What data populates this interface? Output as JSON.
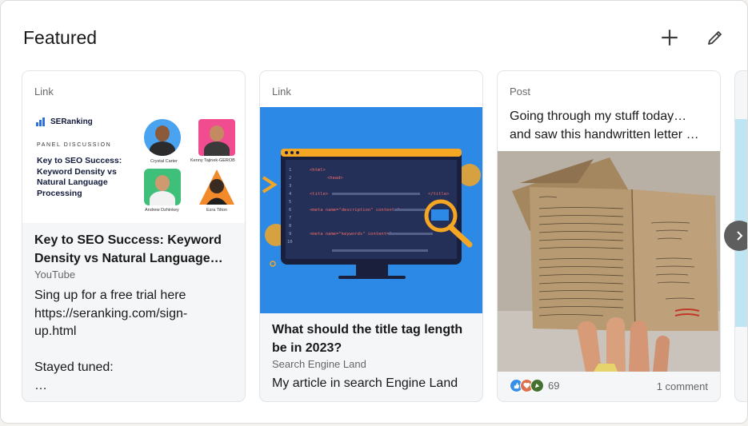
{
  "section": {
    "title": "Featured"
  },
  "header_icons": {
    "add": "plus-icon",
    "edit": "pencil-icon"
  },
  "cards": [
    {
      "type": "Link",
      "thumbnail": {
        "brand": "SERanking",
        "eyebrow": "PANEL DISCUSSION",
        "headline": "Key to SEO Success: Keyword Density vs Natural Language Processing",
        "people": [
          "Crystal Carter",
          "Kenny Tajinek-GEROB",
          "Andrew Dzhinkey",
          "Ezra Tilton"
        ]
      },
      "title": "Key to SEO Success: Keyword Density vs Natural Language…",
      "source": "YouTube",
      "description_lines": [
        "Sing up for a free trial here",
        "https://seranking.com/sign-",
        "up.html",
        "",
        "Stayed tuned:",
        "…"
      ]
    },
    {
      "type": "Link",
      "thumbnail": {
        "code_lines": [
          "<html>",
          "<head>",
          "<title>",
          "</title>",
          "<meta name=\"description\" content=\"",
          "<meta name=\"keywords\" content=\""
        ]
      },
      "title": "What should the title tag length be in 2023?",
      "source": "Search Engine Land",
      "description": "My article in search Engine Land"
    },
    {
      "type": "Post",
      "text": "Going through my stuff today… and saw this handwritten letter …",
      "reaction_count": "69",
      "comments": "1 comment"
    }
  ],
  "colors": {
    "brand_blue": "#0a66c2",
    "card_bg": "#f4f6f8",
    "thumb_blue": "#2d89e6"
  },
  "nav": {
    "next": "chevron-right-icon"
  }
}
